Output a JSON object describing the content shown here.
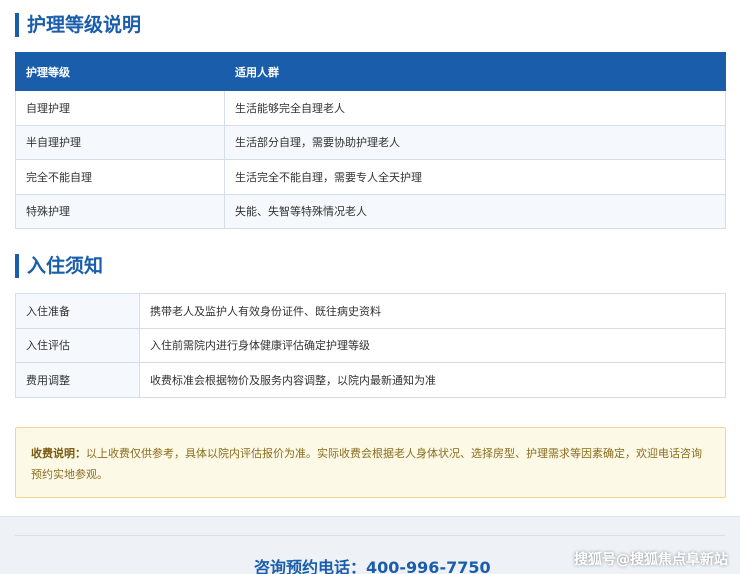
{
  "care_section": {
    "title": "护理等级说明",
    "headers": [
      "护理等级",
      "适用人群"
    ],
    "rows": [
      [
        "自理护理",
        "生活能够完全自理老人"
      ],
      [
        "半自理护理",
        "生活部分自理，需要协助护理老人"
      ],
      [
        "完全不能自理",
        "生活完全不能自理，需要专人全天护理"
      ],
      [
        "特殊护理",
        "失能、失智等特殊情况老人"
      ]
    ]
  },
  "notice_section": {
    "title": "入住须知",
    "rows": [
      [
        "入住准备",
        "携带老人及监护人有效身份证件、既往病史资料"
      ],
      [
        "入住评估",
        "入住前需院内进行身体健康评估确定护理等级"
      ],
      [
        "费用调整",
        "收费标准会根据物价及服务内容调整，以院内最新通知为准"
      ]
    ]
  },
  "fee_note": {
    "label": "收费说明：",
    "text": "以上收费仅供参考，具体以院内评估报价为准。实际收费会根据老人身体状况、选择房型、护理需求等因素确定，欢迎电话咨询预约实地参观。"
  },
  "footer": {
    "phone": "咨询预约电话：400-996-7750",
    "watermark": "搜狐号@搜狐焦点阜新站"
  }
}
